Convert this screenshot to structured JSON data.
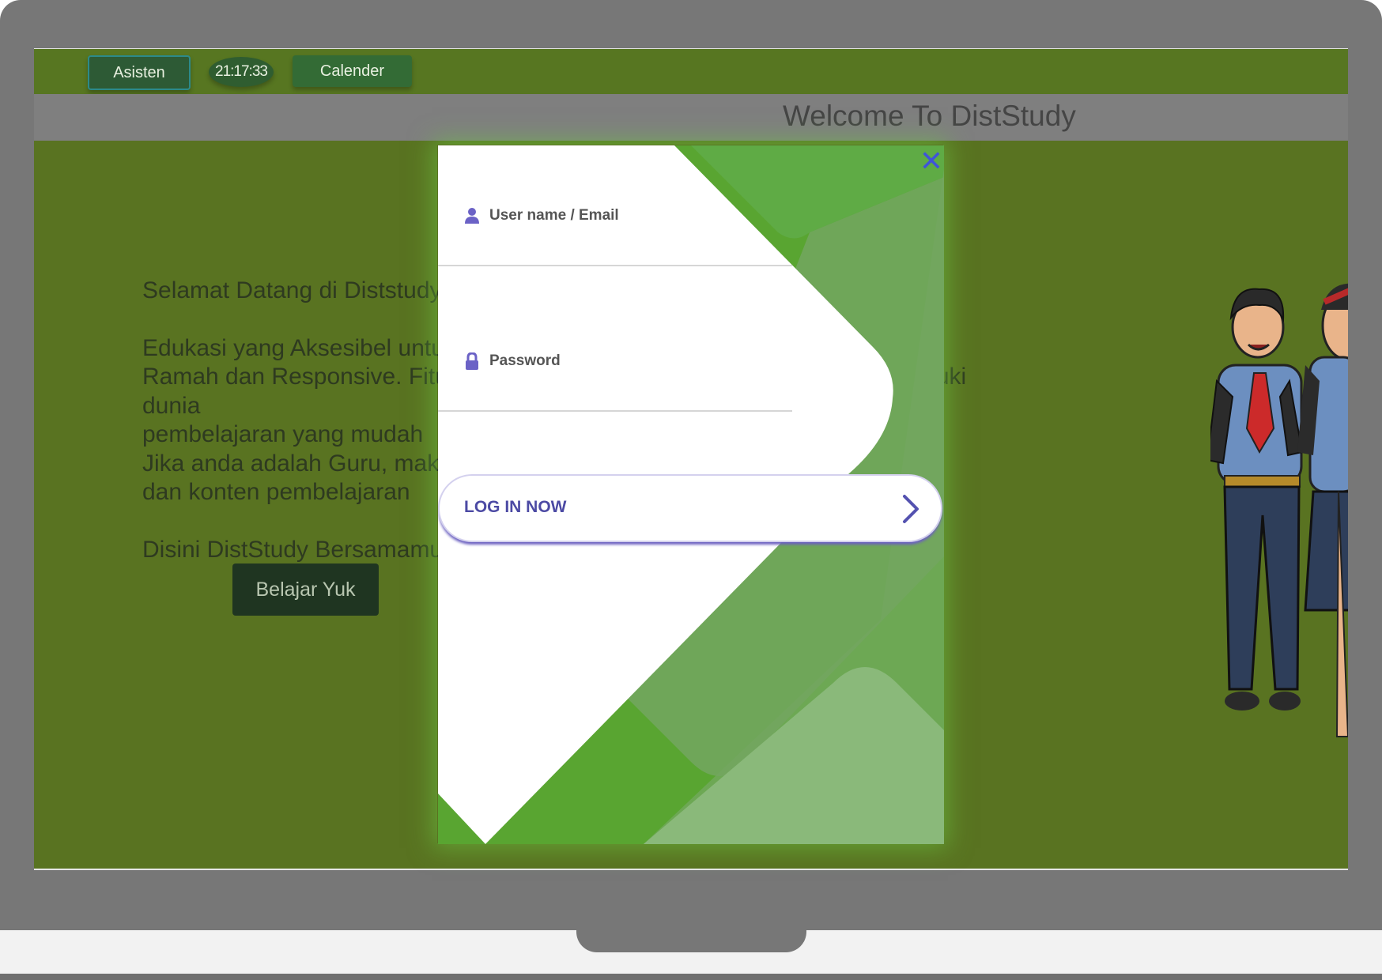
{
  "topbar": {
    "asisten_label": "Asisten",
    "clock_text": "21:17:33",
    "calender_label": "Calender"
  },
  "welcome": {
    "title": "Welcome To DistStudy"
  },
  "hero": {
    "line1": "Selamat Datang di Diststudy",
    "paragraph2": "Edukasi yang Aksesibel untuk Semua\nRamah dan Responsive. Fitur-fitur yang ada dapat membantu anda memasuki dunia\npembelajaran yang mudah\nJika anda adalah Guru, maka\ndan konten pembelajaran",
    "line3": "Disini DistStudy Bersamamu",
    "button_label": "Belajar Yuk"
  },
  "login_modal": {
    "close_label": "✕",
    "username_label": "User name / Email",
    "password_label": "Password",
    "submit_label": "LOG IN NOW",
    "colors": {
      "accent": "#4c4aa4",
      "green": "#5aa335",
      "close": "#3f54d8"
    }
  },
  "icons": {
    "user": "user-icon",
    "lock": "lock-icon",
    "chevron": "chevron-right-icon",
    "close": "close-icon"
  }
}
